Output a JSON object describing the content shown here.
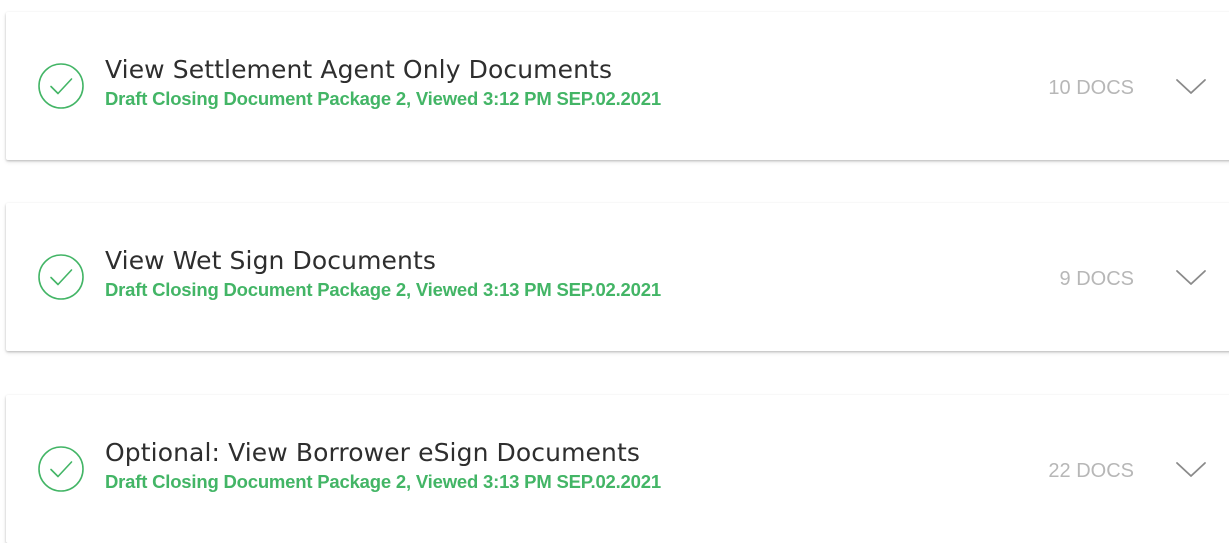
{
  "packages": [
    {
      "title": "View Settlement Agent Only Documents",
      "subtitle": "Draft Closing Document Package 2, Viewed 3:12 PM SEP.02.2021",
      "doc_count": "10 DOCS",
      "status_icon": "check-circle-icon",
      "expand_icon": "chevron-down-icon"
    },
    {
      "title": "View Wet Sign Documents",
      "subtitle": "Draft Closing Document Package 2, Viewed 3:13 PM SEP.02.2021",
      "doc_count": "9 DOCS",
      "status_icon": "check-circle-icon",
      "expand_icon": "chevron-down-icon"
    },
    {
      "title": "Optional: View Borrower eSign Documents",
      "subtitle": "Draft Closing Document Package 2, Viewed 3:13 PM SEP.02.2021",
      "doc_count": "22 DOCS",
      "status_icon": "check-circle-icon",
      "expand_icon": "chevron-down-icon"
    }
  ],
  "colors": {
    "accent_green": "#43b566",
    "title_text": "#2e2e2e",
    "muted_text": "#b7b7b7",
    "chevron": "#8a8a8a"
  }
}
